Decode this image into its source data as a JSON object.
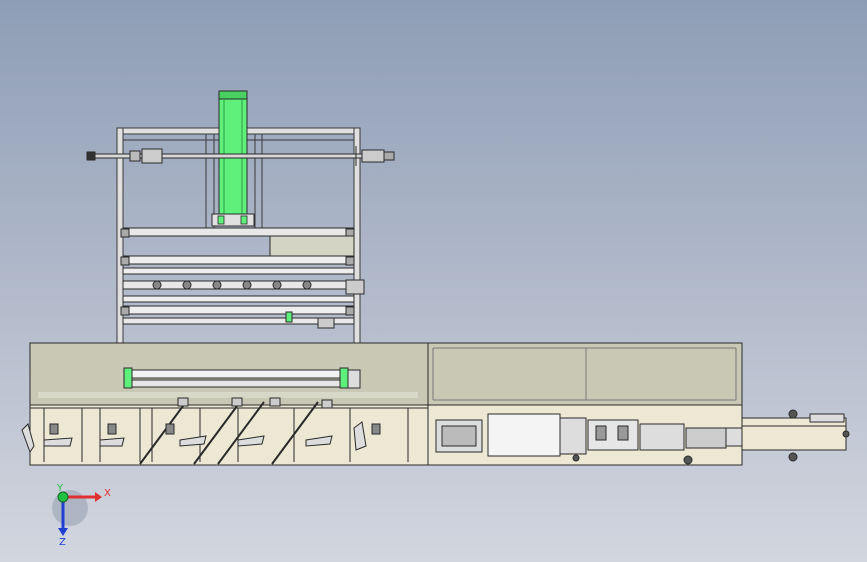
{
  "view": {
    "background_top": "#8e9db6",
    "background_bottom": "#d2d6df"
  },
  "model": {
    "body_color": "#c8c8b4",
    "lower_panel_color": "#ece8d4",
    "frame_color": "#e0e0e0",
    "outline_color": "#3a3a3a",
    "lift_column_color": "#5ef07a",
    "roller_color": "#eeeeee"
  },
  "triad": {
    "x_label": "X",
    "y_label": "Y",
    "z_label": "Z",
    "x_color": "#e03030",
    "y_color": "#20c040",
    "z_color": "#2040d0"
  }
}
